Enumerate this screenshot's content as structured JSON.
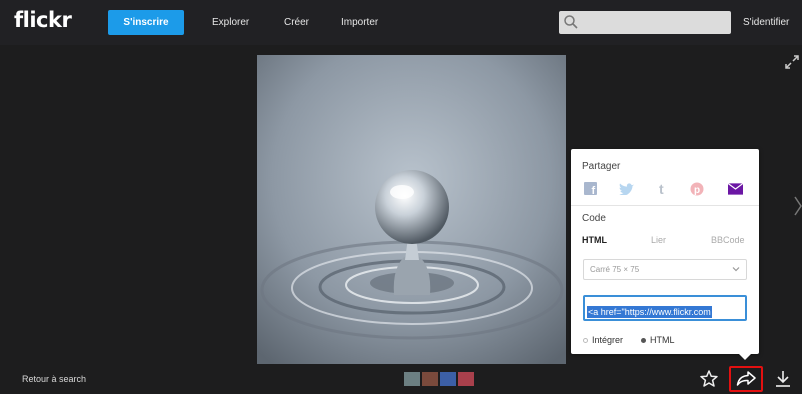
{
  "header": {
    "logo": "flickr",
    "signup_label": "S'inscrire",
    "nav": [
      "Explorer",
      "Créer",
      "Importer"
    ],
    "search_placeholder": "",
    "signin_label": "S'identifier"
  },
  "share_panel": {
    "share_heading": "Partager",
    "social_icons": [
      "facebook-icon",
      "twitter-icon",
      "tumblr-icon",
      "pinterest-icon",
      "email-icon"
    ],
    "code_heading": "Code",
    "code_tabs": [
      "HTML",
      "Lier",
      "BBCode"
    ],
    "active_tab": "HTML",
    "size_select_value": "Carré 75 × 75",
    "embed_code": "<a href=\"https://www.flickr.com",
    "radio_options": [
      "Intégrer",
      "HTML"
    ],
    "selected_radio": "HTML"
  },
  "footer": {
    "back_link": "Retour à search"
  },
  "colors": {
    "accent": "#1c9be9",
    "highlight": "#e31010",
    "selection": "#3478d4",
    "email_purple": "#6b16a4"
  }
}
